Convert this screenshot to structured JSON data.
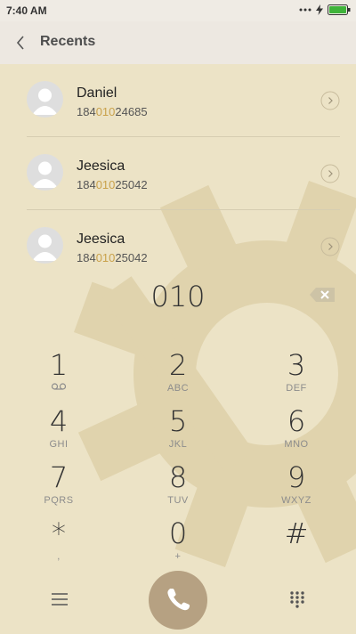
{
  "status_bar": {
    "time": "7:40 AM",
    "icons": [
      "more-dots-icon",
      "flash-icon",
      "battery-icon"
    ],
    "battery_color": "#3fb33a"
  },
  "app_bar": {
    "title": "Recents",
    "back_icon": "back-arrow-icon"
  },
  "recents": [
    {
      "name": "Daniel",
      "number_pre": "184",
      "number_match": "010",
      "number_post": "24685"
    },
    {
      "name": "Jeesica",
      "number_pre": "184",
      "number_match": "010",
      "number_post": "25042"
    },
    {
      "name": "Jeesica",
      "number_pre": "184",
      "number_match": "010",
      "number_post": "25042"
    }
  ],
  "dialer": {
    "number": "010",
    "keys": [
      {
        "digit": "1",
        "letters": "voicemail-icon"
      },
      {
        "digit": "2",
        "letters": "ABC"
      },
      {
        "digit": "3",
        "letters": "DEF"
      },
      {
        "digit": "4",
        "letters": "GHI"
      },
      {
        "digit": "5",
        "letters": "JKL"
      },
      {
        "digit": "6",
        "letters": "MNO"
      },
      {
        "digit": "7",
        "letters": "PQRS"
      },
      {
        "digit": "8",
        "letters": "TUV"
      },
      {
        "digit": "9",
        "letters": "WXYZ"
      },
      {
        "digit": "*",
        "letters": ","
      },
      {
        "digit": "0",
        "letters": "+"
      },
      {
        "digit": "#",
        "letters": ""
      }
    ]
  },
  "colors": {
    "background": "#ece3c6",
    "gear": "#dfd2ac",
    "call_button": "#b6a182",
    "number_highlight": "#c9a14a"
  }
}
